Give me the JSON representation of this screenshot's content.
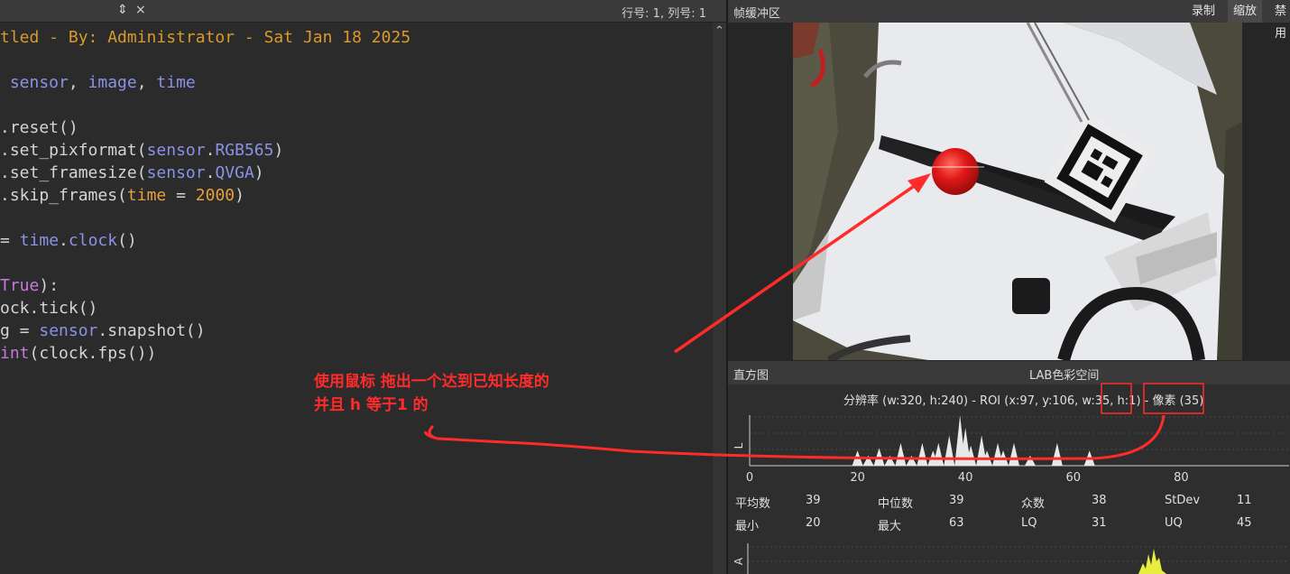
{
  "editor": {
    "toolbar_arrows": "⇕",
    "toolbar_close": "×",
    "cursor_position": "行号: 1, 列号: 1",
    "lines": [
      {
        "parts": [
          [
            "cm",
            "tled - By: Administrator - Sat Jan 18 2025"
          ]
        ]
      },
      {
        "parts": [
          [
            "mod",
            " sensor"
          ],
          [
            "fn",
            ", "
          ],
          [
            "mod",
            "image"
          ],
          [
            "fn",
            ", "
          ],
          [
            "mod",
            "time"
          ]
        ]
      },
      {
        "parts": [
          [
            "fn",
            ".reset()"
          ]
        ]
      },
      {
        "parts": [
          [
            "fn",
            ".set_pixformat("
          ],
          [
            "mod",
            "sensor"
          ],
          [
            "fn",
            "."
          ],
          [
            "mod",
            "RGB565"
          ],
          [
            "fn",
            ")"
          ]
        ]
      },
      {
        "parts": [
          [
            "fn",
            ".set_framesize("
          ],
          [
            "mod",
            "sensor"
          ],
          [
            "fn",
            "."
          ],
          [
            "mod",
            "QVGA"
          ],
          [
            "fn",
            ")"
          ]
        ]
      },
      {
        "parts": [
          [
            "fn",
            ".skip_frames("
          ],
          [
            "num",
            "time"
          ],
          [
            "fn",
            " = "
          ],
          [
            "num",
            "2000"
          ],
          [
            "fn",
            ")"
          ]
        ]
      },
      {
        "parts": [
          [
            "fn",
            "= "
          ],
          [
            "mod",
            "time"
          ],
          [
            "fn",
            "."
          ],
          [
            "mod",
            "clock"
          ],
          [
            "fn",
            "()"
          ]
        ]
      },
      {
        "parts": [
          [
            "kw",
            "True"
          ],
          [
            "fn",
            "):"
          ]
        ]
      },
      {
        "parts": [
          [
            "fn",
            "ock.tick()"
          ]
        ]
      },
      {
        "parts": [
          [
            "fn",
            "g = "
          ],
          [
            "mod",
            "sensor"
          ],
          [
            "fn",
            ".snapshot()"
          ]
        ]
      },
      {
        "parts": [
          [
            "kw",
            "int"
          ],
          [
            "fn",
            "(clock.fps())"
          ]
        ]
      }
    ]
  },
  "framebuffer": {
    "title": "帧缓冲区",
    "buttons": {
      "record": "录制",
      "zoom": "缩放",
      "disable": "禁用"
    }
  },
  "histogram": {
    "title": "直方图",
    "colorspace": "LAB色彩空间",
    "res_prefix": "分辨率 (w:320, h:240) - ROI (x:97, y:106, w:35, ",
    "res_h": "h:1",
    "res_mid": ") - ",
    "res_pixels": "像素 (35)",
    "l_axis_label": "L",
    "a_axis_label": "A",
    "l_ticks": [
      "0",
      "20",
      "40",
      "60",
      "80"
    ],
    "l_histogram": [
      {
        "v": 20,
        "h": 0.3
      },
      {
        "v": 22,
        "h": 0.2
      },
      {
        "v": 24,
        "h": 0.35
      },
      {
        "v": 26,
        "h": 0.2
      },
      {
        "v": 28,
        "h": 0.45
      },
      {
        "v": 30,
        "h": 0.2
      },
      {
        "v": 32,
        "h": 0.45
      },
      {
        "v": 34,
        "h": 0.3
      },
      {
        "v": 35,
        "h": 0.45
      },
      {
        "v": 37,
        "h": 0.6
      },
      {
        "v": 39,
        "h": 1.0
      },
      {
        "v": 40,
        "h": 0.75
      },
      {
        "v": 41,
        "h": 0.4
      },
      {
        "v": 43,
        "h": 0.6
      },
      {
        "v": 44,
        "h": 0.3
      },
      {
        "v": 46,
        "h": 0.45
      },
      {
        "v": 47,
        "h": 0.3
      },
      {
        "v": 49,
        "h": 0.45
      },
      {
        "v": 52,
        "h": 0.2
      },
      {
        "v": 57,
        "h": 0.45
      },
      {
        "v": 63,
        "h": 0.3
      }
    ],
    "stats": {
      "mean_label": "平均数",
      "mean": "39",
      "median_label": "中位数",
      "median": "39",
      "mode_label": "众数",
      "mode": "38",
      "stdev_label": "StDev",
      "stdev": "11",
      "min_label": "最小",
      "min": "20",
      "max_label": "最大",
      "max": "63",
      "lq_label": "LQ",
      "lq": "31",
      "uq_label": "UQ",
      "uq": "45"
    }
  },
  "annotation": {
    "line1": "使用鼠标 拖出一个达到已知长度的",
    "line2": "并且 h 等于1 的"
  },
  "colors": {
    "annotation_red": "#ff2b2b",
    "ball_red": "#e01818",
    "a_channel_yellow": "#e8ee40"
  }
}
